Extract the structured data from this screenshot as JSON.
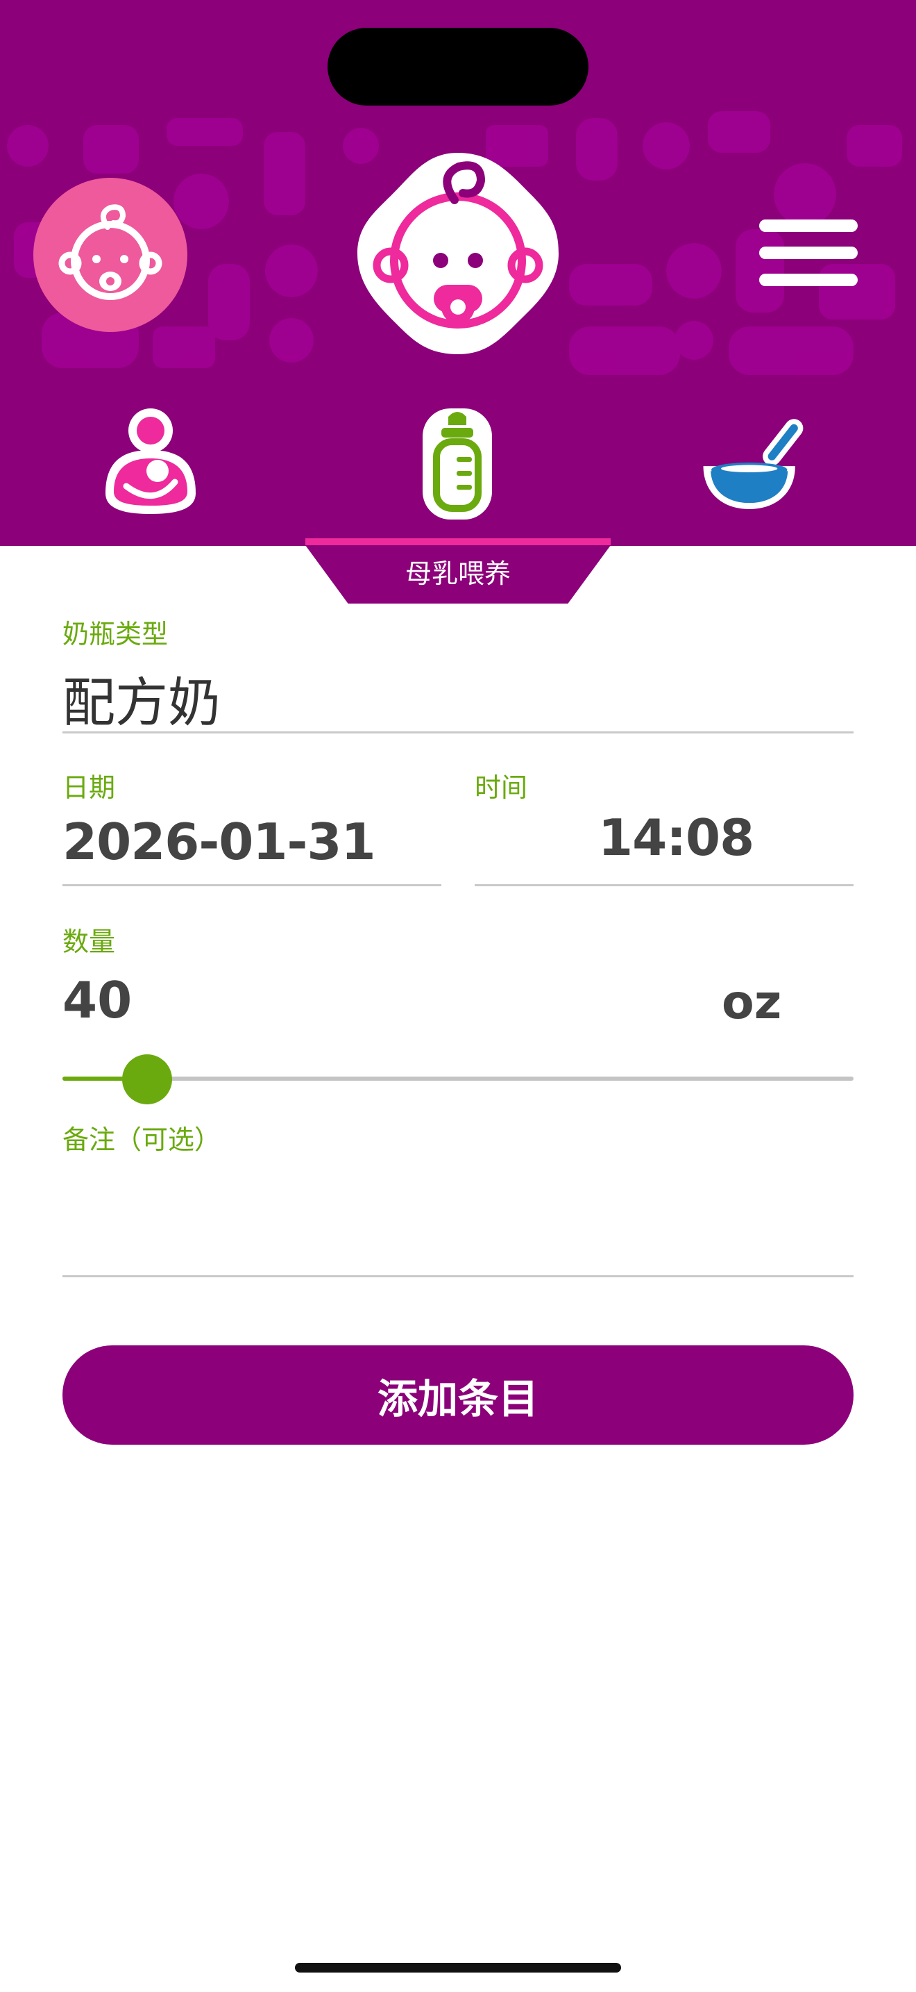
{
  "colors": {
    "header_bg": "#8c007a",
    "accent_green": "#6aaa0e",
    "accent_pink": "#ee2a9c",
    "profile_pink": "#ee5a9c",
    "solid_blue": "#1f7fc4"
  },
  "icons": {
    "profile": "baby-face-icon",
    "logo": "baby-pacifier-logo",
    "menu": "hamburger-menu-icon",
    "tab_breast": "breastfeeding-icon",
    "tab_bottle": "baby-bottle-icon",
    "tab_solid": "food-bowl-icon"
  },
  "tabs": {
    "active_label": "母乳喂养"
  },
  "form": {
    "bottle_type": {
      "label": "奶瓶类型",
      "value": "配方奶"
    },
    "date": {
      "label": "日期",
      "value": "2026-01-31"
    },
    "time": {
      "label": "时间",
      "value": "14:08"
    },
    "quantity": {
      "label": "数量",
      "value": "40",
      "unit": "oz",
      "slider_fraction": 0.107
    },
    "notes": {
      "label": "备注（可选）",
      "value": ""
    }
  },
  "actions": {
    "add_label": "添加条目"
  }
}
